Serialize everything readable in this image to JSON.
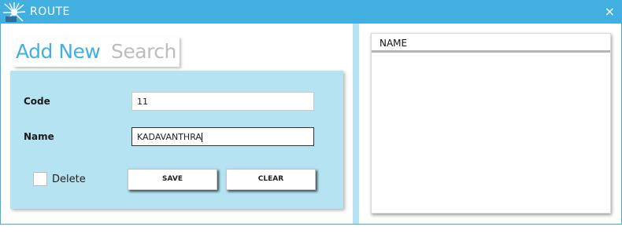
{
  "window": {
    "title": "ROUTE",
    "close_icon": "×"
  },
  "tabs": {
    "add_new": "Add New",
    "search": "Search"
  },
  "form": {
    "code_label": "Code",
    "code_value": "11",
    "name_label": "Name",
    "name_value": "KADAVANTHRA",
    "delete_label": "Delete",
    "delete_checked": false,
    "save_label": "SAVE",
    "clear_label": "CLEAR"
  },
  "grid": {
    "columns": [
      "NAME"
    ],
    "rows": []
  },
  "colors": {
    "accent": "#41b0e0",
    "panel": "#b5e3f2"
  }
}
